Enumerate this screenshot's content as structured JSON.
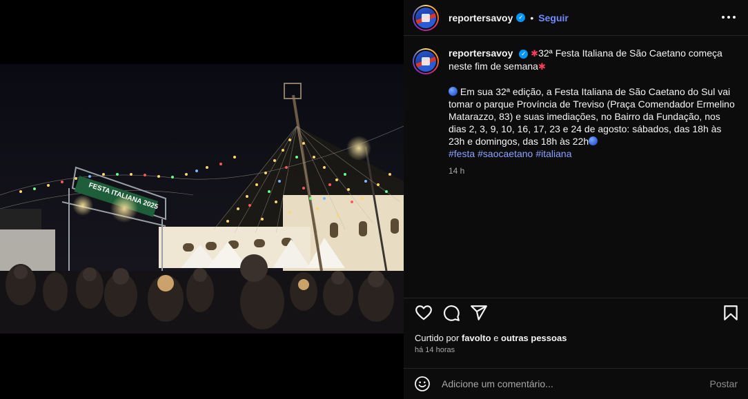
{
  "post": {
    "author": "reportersavoy",
    "follow_label": "Seguir",
    "separator": "•",
    "caption_title": "32ª Festa Italiana de São Caetano começa neste fim de semana",
    "caption_body": "Em sua 32ª edição, a Festa Italiana de São Caetano do Sul vai tomar o parque Província de Treviso (Praça Comendador Ermelino Matarazzo, 83) e suas imediações, no Bairro da Fundação, nos dias 2, 3, 9, 10, 16, 17, 23 e 24 de agosto: sábados, das 18h às 23h e domingos, das 18h às 22h",
    "hashtags": [
      "#festa",
      "#saocaetano",
      "#italiana"
    ],
    "caption_time": "14 h",
    "liked_prefix": "Curtido por",
    "liked_user": "favolto",
    "liked_conj": "e",
    "liked_others": "outras pessoas",
    "posted_ago": "há 14 horas"
  },
  "photo": {
    "banner_text": "FESTA ITALIANA 2025"
  },
  "comment": {
    "placeholder": "Adicione um comentário...",
    "post_label": "Postar"
  },
  "icons": {
    "verified": "verified-badge-icon",
    "more": "more-options-icon",
    "like": "heart-icon",
    "comment": "comment-bubble-icon",
    "share": "paper-plane-icon",
    "save": "bookmark-icon",
    "emoji": "smiley-icon"
  },
  "colors": {
    "accent_link": "#6f8cff",
    "hashtag": "#8aa3ff",
    "verified": "#0095f6",
    "panel_bg": "#0c0c0c"
  }
}
